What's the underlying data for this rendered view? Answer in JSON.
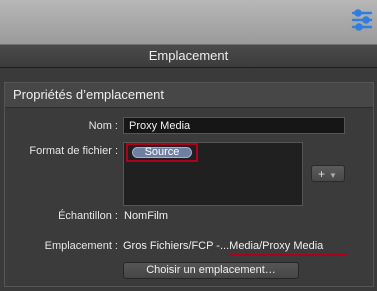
{
  "window": {
    "title": "Emplacement"
  },
  "panel": {
    "heading": "Propriétés d’emplacement"
  },
  "fields": {
    "name_label": "Nom :",
    "name_value": "Proxy Media",
    "format_label": "Format de fichier :",
    "format_token": "Source",
    "sample_label": "Échantillon :",
    "sample_value": "NomFilm",
    "location_label": "Emplacement :",
    "location_prefix": "Gros Fichiers/FCP -",
    "location_suffix": "...Media/Proxy Media"
  },
  "buttons": {
    "add_label": "+",
    "choose_label": "Choisir un emplacement…"
  },
  "icons": {
    "settings": "settings-sliders-icon",
    "add_dropdown": "chevron-down-icon"
  },
  "colors": {
    "highlight": "#b00020",
    "token": "#6e7fa2",
    "settings_icon": "#2f7fe0"
  }
}
